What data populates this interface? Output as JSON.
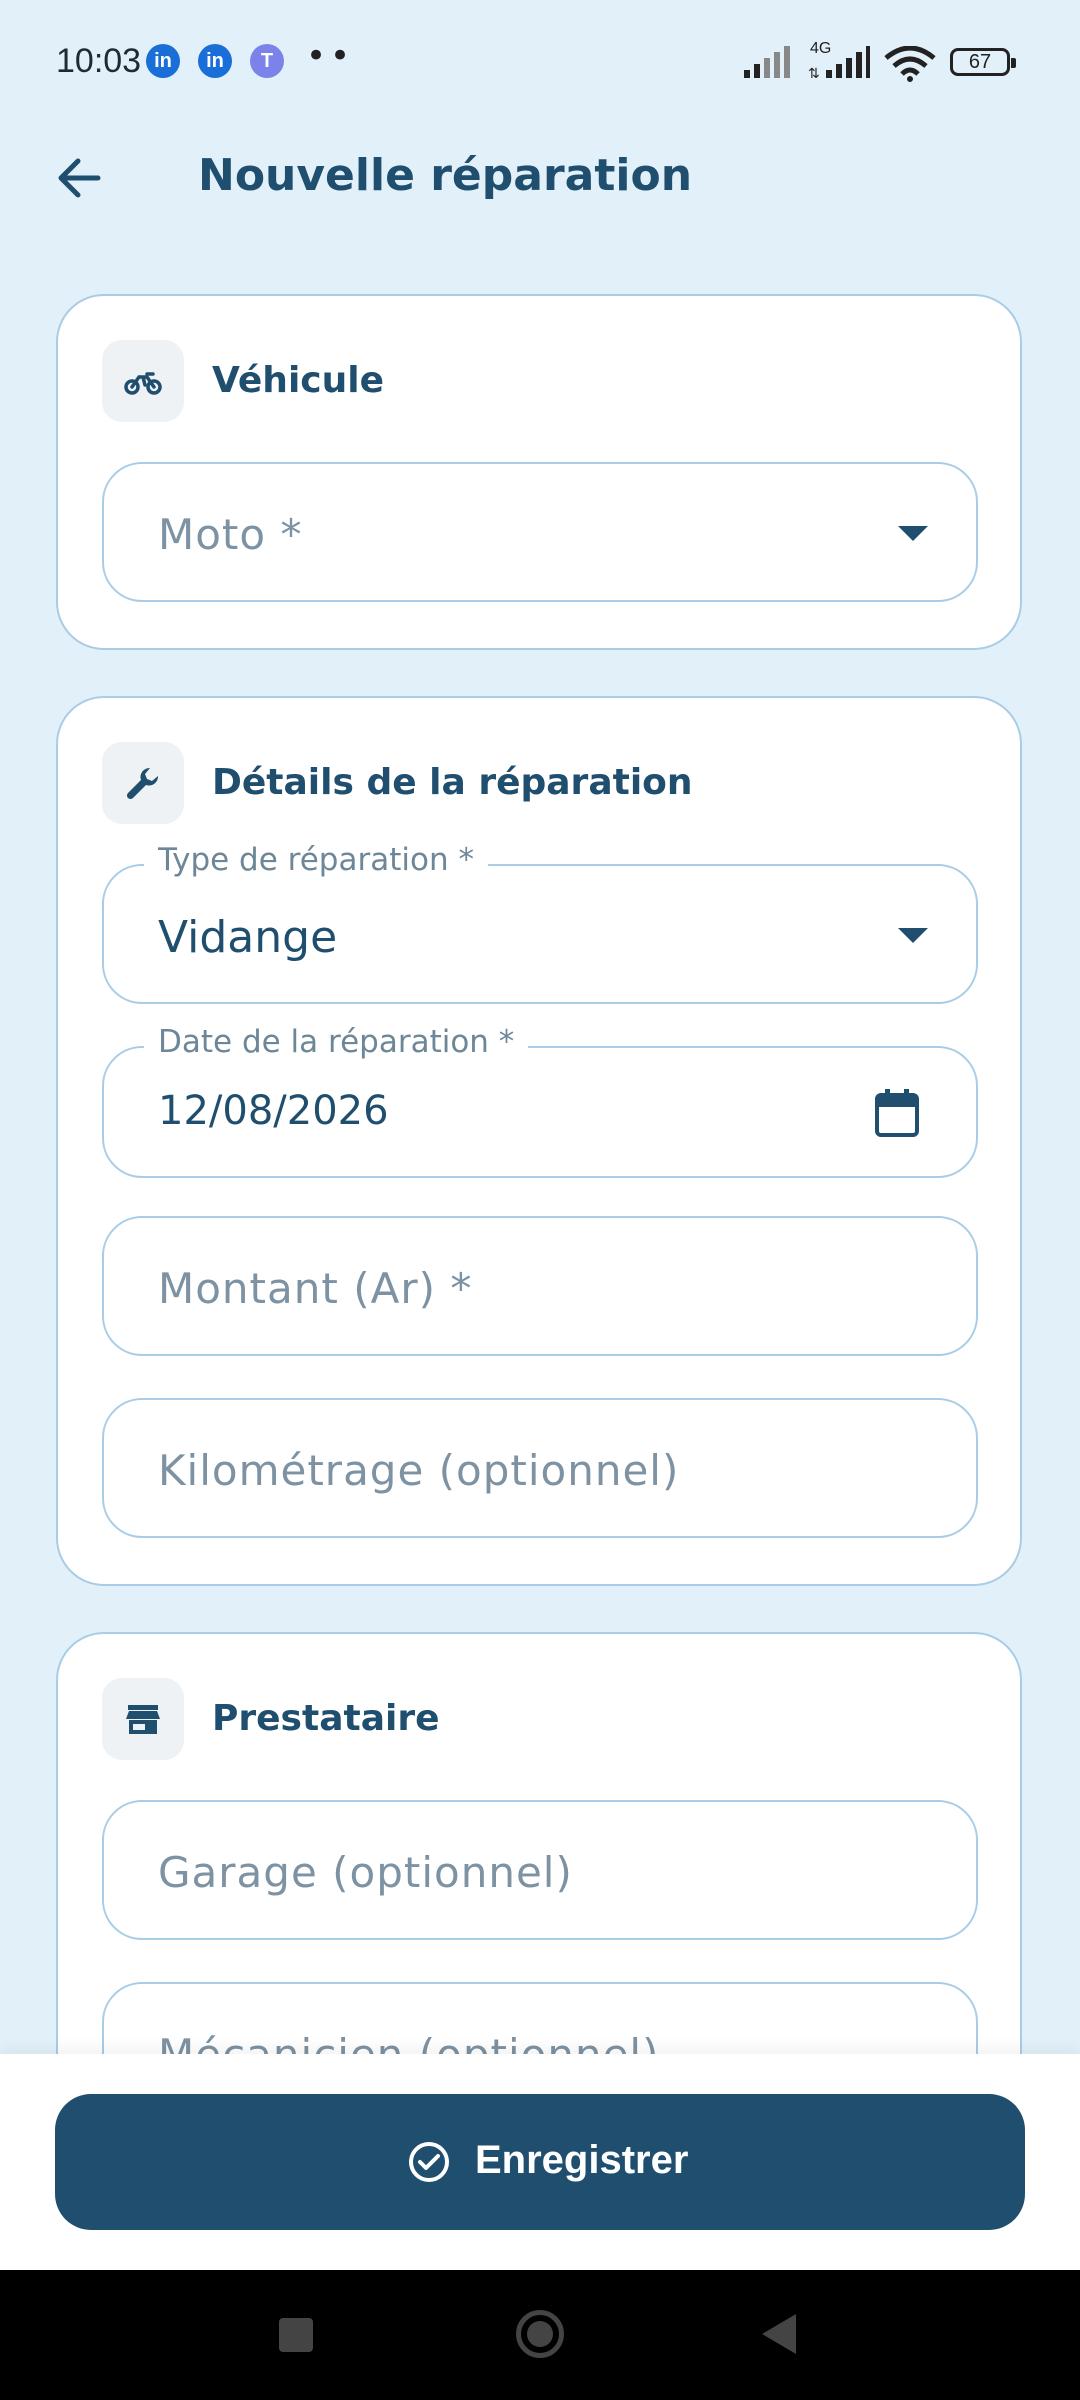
{
  "status_bar": {
    "time": "10:03",
    "notification_icons": [
      "linkedin-icon",
      "linkedin-icon",
      "teams-icon"
    ],
    "more": "••",
    "network": "4G",
    "battery": "67"
  },
  "app_bar": {
    "back_icon": "arrow-left-icon",
    "title": "Nouvelle réparation"
  },
  "vehicle_card": {
    "icon": "motorcycle-icon",
    "title": "Véhicule",
    "moto_placeholder": "Moto *"
  },
  "details_card": {
    "icon": "wrench-icon",
    "title": "Détails de la réparation",
    "repair_type_label": "Type de réparation *",
    "repair_type_value": "Vidange",
    "date_label": "Date de la réparation *",
    "date_value": "12/08/2026",
    "amount_placeholder": "Montant (Ar) *",
    "mileage_placeholder": "Kilométrage (optionnel)"
  },
  "provider_card": {
    "icon": "store-icon",
    "title": "Prestataire",
    "garage_placeholder": "Garage (optionnel)",
    "mechanic_placeholder": "Mécanicien (optionnel)"
  },
  "actions": {
    "save_label": "Enregistrer",
    "save_icon": "check-circle-icon"
  },
  "colors": {
    "primary": "#1f4e6e",
    "background": "#e2f0f9",
    "border": "#a9cde6"
  }
}
